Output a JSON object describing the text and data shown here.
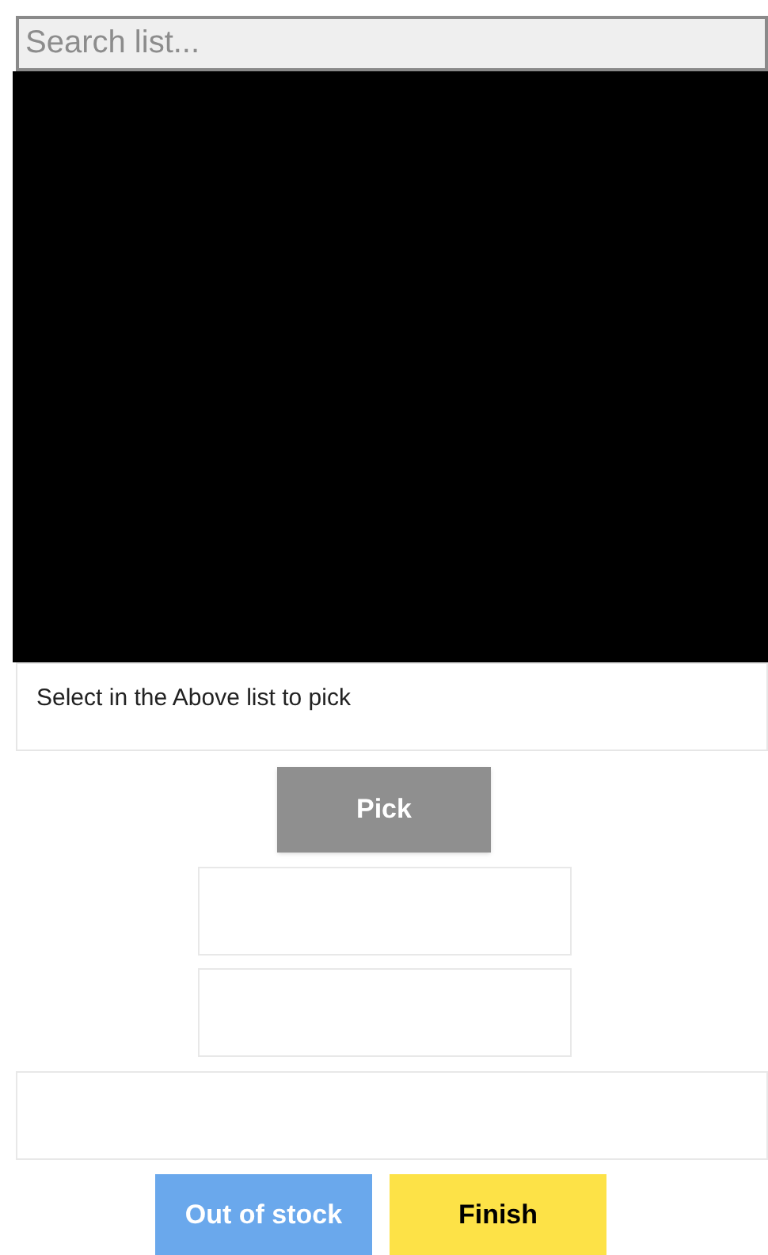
{
  "search": {
    "placeholder": "Search list..."
  },
  "status_message": "Select in the Above list to pick",
  "pick_button": {
    "label": "Pick",
    "disabled": true
  },
  "buttons": [
    {
      "label": "Out of stock",
      "kind": "secondary"
    },
    {
      "label": "Finish",
      "kind": "primary"
    }
  ]
}
